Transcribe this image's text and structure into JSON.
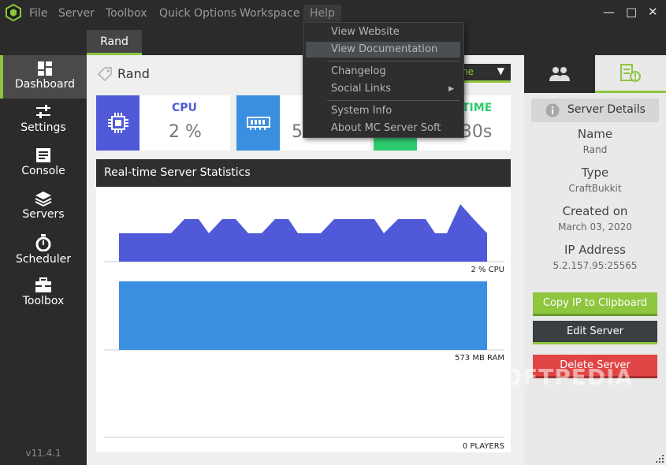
{
  "menu": {
    "items": [
      "File",
      "Server",
      "Toolbox",
      "Quick Options",
      "Workspace",
      "Help"
    ],
    "window_controls": [
      "—",
      "□",
      "✕"
    ]
  },
  "help_menu": {
    "items": [
      "View Website",
      "View Documentation",
      "Changelog",
      "Social Links",
      "System Info",
      "About MC Server Soft"
    ],
    "highlighted": "View Documentation"
  },
  "tabs": [
    {
      "label": "Rand"
    }
  ],
  "sidebar": {
    "items": [
      {
        "label": "Dashboard",
        "icon": "dashboard-icon"
      },
      {
        "label": "Settings",
        "icon": "sliders-icon"
      },
      {
        "label": "Console",
        "icon": "console-icon"
      },
      {
        "label": "Servers",
        "icon": "layers-icon"
      },
      {
        "label": "Scheduler",
        "icon": "stopwatch-icon"
      },
      {
        "label": "Toolbox",
        "icon": "toolbox-icon"
      }
    ],
    "version": "v11.4.1"
  },
  "main": {
    "server_name": "Rand",
    "dropdown_partial": "ne",
    "cards": {
      "cpu": {
        "title": "CPU",
        "value": "2 %"
      },
      "ram": {
        "title": "",
        "value": "573 MB"
      },
      "uptime": {
        "title": "TIME",
        "value": "1h 30s"
      }
    },
    "stats_title": "Real-time Server Statistics",
    "cpu_label": "2 % CPU",
    "ram_label": "573 MB RAM",
    "players_label": "0 PLAYERS"
  },
  "details": {
    "title": "Server Details",
    "name_label": "Name",
    "name_value": "Rand",
    "type_label": "Type",
    "type_value": "CraftBukkit",
    "created_label": "Created on",
    "created_value": "March 03, 2020",
    "ip_label": "IP Address",
    "ip_value": "5.2.157.95:25565",
    "copy_button": "Copy IP to Clipboard",
    "edit_button": "Edit Server",
    "delete_button": "Delete Server"
  },
  "colors": {
    "accent_green": "#8ec63f",
    "cpu_purple": "#5059d8",
    "ram_blue": "#3a8fe0",
    "uptime_green": "#2ecc71",
    "delete_red": "#e04545",
    "edit_dark": "#3a3f41"
  },
  "watermark": "SOFTPEDIA"
}
